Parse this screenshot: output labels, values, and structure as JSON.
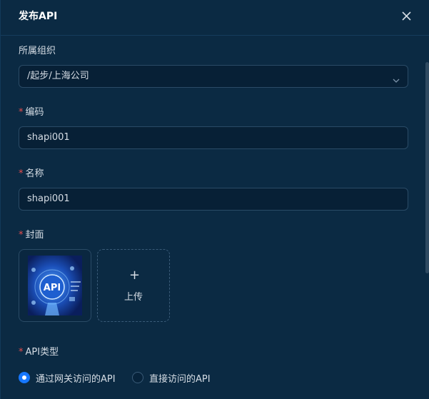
{
  "dialog": {
    "title": "发布API",
    "close_icon": "close-icon"
  },
  "form": {
    "org": {
      "label": "所属组织",
      "value": "/起步/上海公司",
      "icon": "chevron-down-icon"
    },
    "code": {
      "label": "编码",
      "required_mark": "*",
      "value": "shapi001"
    },
    "name": {
      "label": "名称",
      "required_mark": "*",
      "value": "shapi001"
    },
    "cover": {
      "label": "封面",
      "required_mark": "*",
      "upload_label": "上传",
      "upload_symbol": "+",
      "thumbnail_text": "API"
    },
    "api_type": {
      "label": "API类型",
      "required_mark": "*",
      "options": [
        {
          "label": "通过网关访问的API",
          "selected": true
        },
        {
          "label": "直接访问的API",
          "selected": false
        }
      ]
    }
  },
  "colors": {
    "background": "#0b2a43",
    "accent": "#1677ff",
    "required": "#e84d4d"
  }
}
